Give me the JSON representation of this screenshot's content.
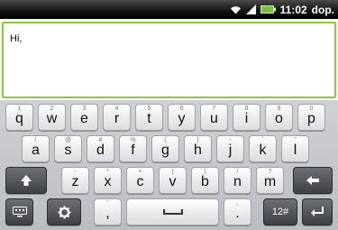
{
  "status": {
    "time": "11:02",
    "ampm": "dop.",
    "icons": [
      "wifi-icon",
      "signal-icon",
      "battery-icon"
    ]
  },
  "compose": {
    "text": "Hi,"
  },
  "keyboard": {
    "row1": [
      {
        "main": "q",
        "alt": "1"
      },
      {
        "main": "w",
        "alt": "2"
      },
      {
        "main": "e",
        "alt": "3"
      },
      {
        "main": "r",
        "alt": "4"
      },
      {
        "main": "t",
        "alt": "5"
      },
      {
        "main": "y",
        "alt": "6"
      },
      {
        "main": "u",
        "alt": "7"
      },
      {
        "main": "i",
        "alt": "8"
      },
      {
        "main": "o",
        "alt": "9"
      },
      {
        "main": "p",
        "alt": "0"
      }
    ],
    "row2": [
      {
        "main": "a",
        "alt": "!"
      },
      {
        "main": "s",
        "alt": "@"
      },
      {
        "main": "d",
        "alt": "#"
      },
      {
        "main": "f",
        "alt": "%"
      },
      {
        "main": "g",
        "alt": "("
      },
      {
        "main": "h",
        "alt": ")"
      },
      {
        "main": "j",
        "alt": "-"
      },
      {
        "main": "k",
        "alt": "'"
      },
      {
        "main": "l",
        "alt": "\""
      }
    ],
    "row3": [
      {
        "main": "z",
        "alt": "-"
      },
      {
        "main": "x",
        "alt": "*"
      },
      {
        "main": "c",
        "alt": "+"
      },
      {
        "main": "v",
        "alt": "("
      },
      {
        "main": "b",
        "alt": ")"
      },
      {
        "main": "n",
        "alt": "/"
      },
      {
        "main": "m",
        "alt": "?"
      }
    ],
    "row4": {
      "left_punct": {
        "main": ",",
        "alt": "'"
      },
      "right_punct": {
        "main": ".",
        "alt": ","
      },
      "numbers_label": "12#"
    }
  }
}
